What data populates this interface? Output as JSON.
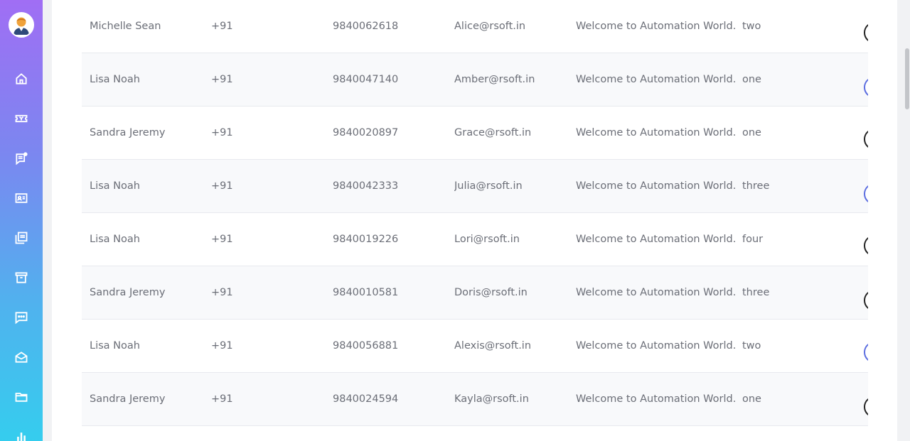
{
  "sidebar": {
    "items": [
      {
        "icon": "home-icon"
      },
      {
        "icon": "ticket-icon"
      },
      {
        "icon": "chat-list-icon"
      },
      {
        "icon": "contact-card-icon"
      },
      {
        "icon": "pdf-gallery-icon"
      },
      {
        "icon": "archive-icon"
      },
      {
        "icon": "message-icon"
      },
      {
        "icon": "mail-open-icon"
      },
      {
        "icon": "folder-icon"
      },
      {
        "icon": "chart-icon"
      }
    ],
    "gradient": [
      "#a06ef4",
      "#35cdee"
    ]
  },
  "table": {
    "rows": [
      {
        "name": "Michelle Sean",
        "code": "+91",
        "phone": "9840062618",
        "email": "Alice@rsoft.in",
        "message": "Welcome to Automation World...!",
        "count": "two"
      },
      {
        "name": "Lisa Noah",
        "code": "+91",
        "phone": "9840047140",
        "email": "Amber@rsoft.in",
        "message": "Welcome to Automation World...!",
        "count": "one"
      },
      {
        "name": "Sandra Jeremy",
        "code": "+91",
        "phone": "9840020897",
        "email": "Grace@rsoft.in",
        "message": "Welcome to Automation World...!",
        "count": "one"
      },
      {
        "name": "Lisa Noah",
        "code": "+91",
        "phone": "9840042333",
        "email": "Julia@rsoft.in",
        "message": "Welcome to Automation World...!",
        "count": "three"
      },
      {
        "name": "Lisa Noah",
        "code": "+91",
        "phone": "9840019226",
        "email": "Lori@rsoft.in",
        "message": "Welcome to Automation World...!",
        "count": "four"
      },
      {
        "name": "Sandra Jeremy",
        "code": "+91",
        "phone": "9840010581",
        "email": "Doris@rsoft.in",
        "message": "Welcome to Automation World...!",
        "count": "three"
      },
      {
        "name": "Lisa Noah",
        "code": "+91",
        "phone": "9840056881",
        "email": "Alexis@rsoft.in",
        "message": "Welcome to Automation World...!",
        "count": "two"
      },
      {
        "name": "Sandra Jeremy",
        "code": "+91",
        "phone": "9840024594",
        "email": "Kayla@rsoft.in",
        "message": "Welcome to Automation World...!",
        "count": "one"
      }
    ]
  }
}
